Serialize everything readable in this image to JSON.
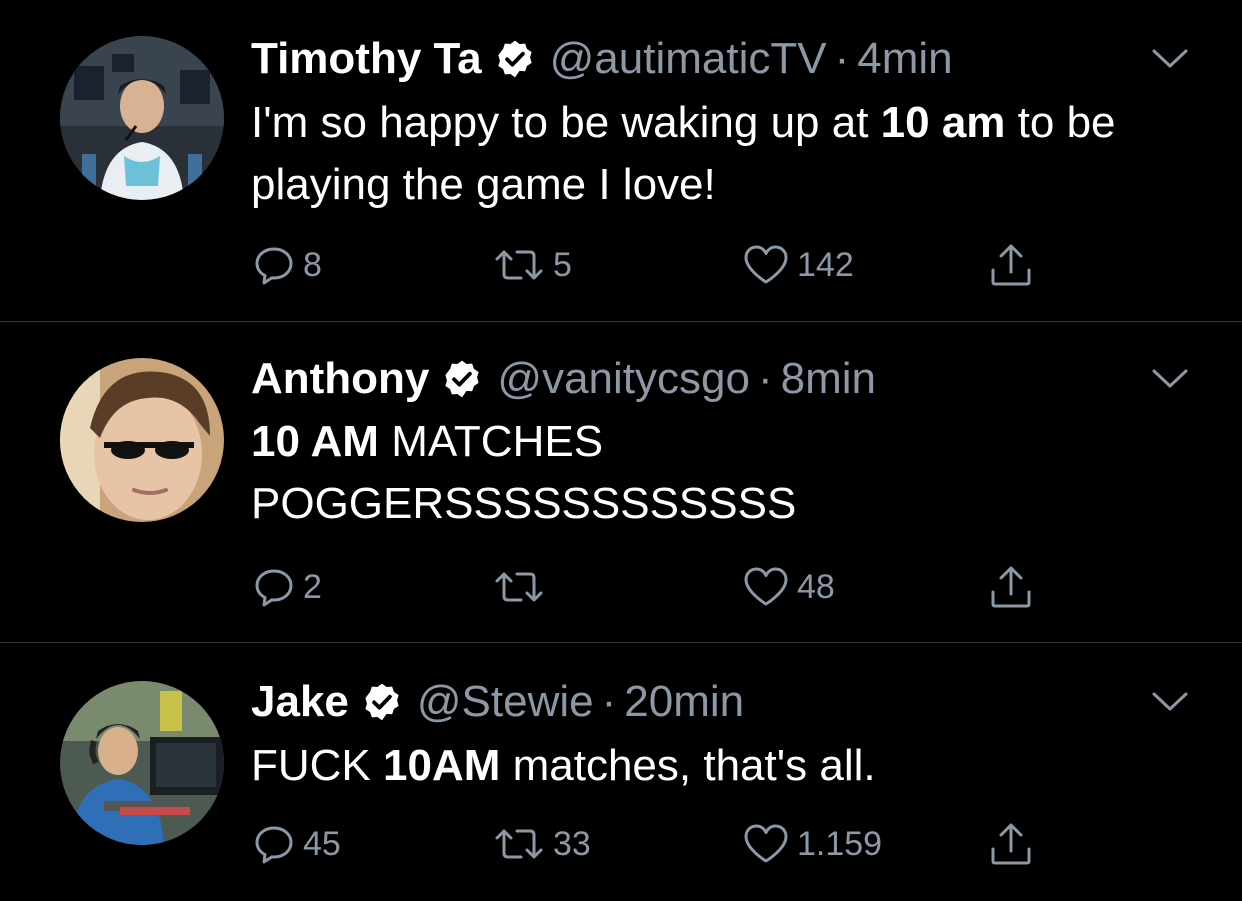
{
  "tweets": [
    {
      "name": "Timothy Ta",
      "handle": "@autimaticTV",
      "separator": "·",
      "time": "4min",
      "text_parts": [
        {
          "t": "I'm so happy to be waking up at ",
          "bold": false
        },
        {
          "t": "10 am",
          "bold": true
        },
        {
          "t": " to be playing the game I love!",
          "bold": false
        }
      ],
      "replies": "8",
      "retweets": "5",
      "likes": "142"
    },
    {
      "name": "Anthony",
      "handle": "@vanitycsgo",
      "separator": "·",
      "time": "8min",
      "text_parts": [
        {
          "t": "10 AM",
          "bold": true
        },
        {
          "t": " MATCHES POGGERSSSSSSSSSSSS",
          "bold": false
        }
      ],
      "replies": "2",
      "retweets": "",
      "likes": "48"
    },
    {
      "name": "Jake",
      "handle": "@Stewie",
      "separator": "·",
      "time": "20min",
      "text_parts": [
        {
          "t": "FUCK ",
          "bold": false
        },
        {
          "t": "10AM",
          "bold": true
        },
        {
          "t": " matches, that's all.",
          "bold": false
        }
      ],
      "replies": "45",
      "retweets": "33",
      "likes": "1.159"
    }
  ],
  "icons": {
    "verified": "verified-badge-icon",
    "caret": "chevron-down-icon",
    "reply": "reply-icon",
    "retweet": "retweet-icon",
    "like": "heart-icon",
    "share": "share-icon"
  },
  "colors": {
    "background": "#000000",
    "text": "#ffffff",
    "secondary": "#8b98a5",
    "divider": "#2f3336"
  }
}
